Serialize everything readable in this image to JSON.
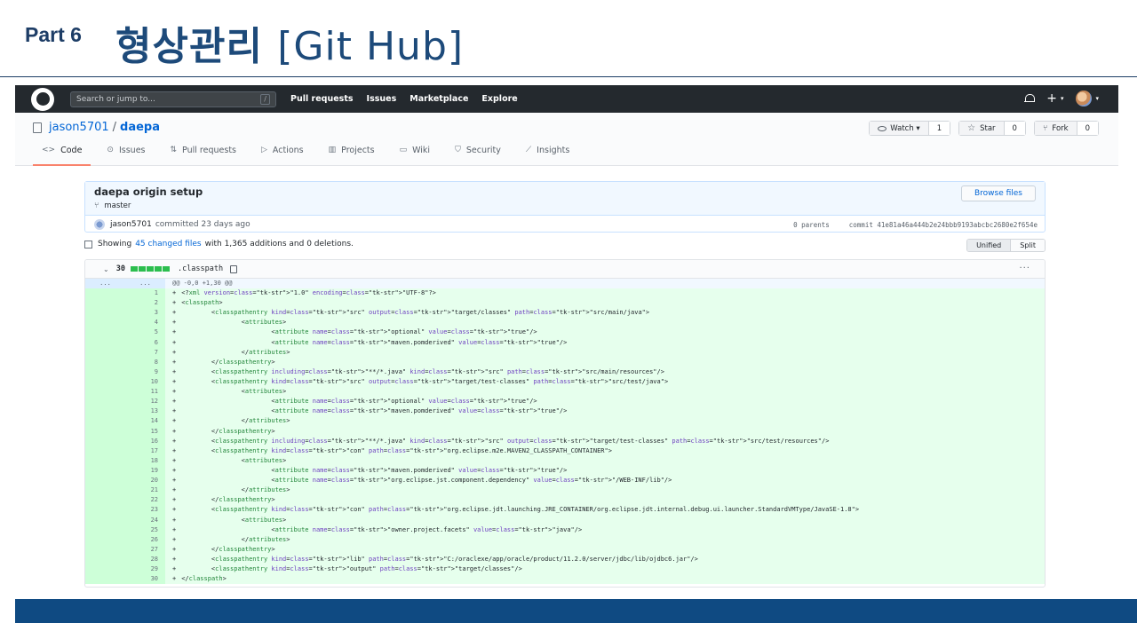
{
  "slide": {
    "part": "Part 6",
    "title": "형상관리",
    "title_suffix": "[Git Hub]"
  },
  "github": {
    "search": {
      "placeholder": "Search or jump to...",
      "shortcut": "/"
    },
    "nav": [
      "Pull requests",
      "Issues",
      "Marketplace",
      "Explore"
    ],
    "header_right": {
      "plus": "+",
      "caret": "▾"
    },
    "repo": {
      "owner": "jason5701",
      "separator": "/",
      "name": "daepa",
      "watch": {
        "label": "Watch",
        "count": "1"
      },
      "star": {
        "label": "Star",
        "count": "0"
      },
      "fork": {
        "label": "Fork",
        "count": "0"
      }
    },
    "tabs": [
      {
        "label": "Code",
        "icon": "<>"
      },
      {
        "label": "Issues",
        "icon": "⊙"
      },
      {
        "label": "Pull requests",
        "icon": "⇅"
      },
      {
        "label": "Actions",
        "icon": "▷"
      },
      {
        "label": "Projects",
        "icon": "▥"
      },
      {
        "label": "Wiki",
        "icon": "▭"
      },
      {
        "label": "Security",
        "icon": "⛉"
      },
      {
        "label": "Insights",
        "icon": "⟋"
      }
    ],
    "commit": {
      "title": "daepa origin setup",
      "branch": "master",
      "author": "jason5701",
      "committed": "committed 23 days ago",
      "parents": "0 parents",
      "commit_label": "commit",
      "sha": "41e81a46a444b2e24bbb9193abcbc2680e2f654e",
      "browse_label": "Browse files"
    },
    "summary": {
      "prefix": "Showing",
      "changed": "45 changed files",
      "suffix": "with 1,365 additions and 0 deletions."
    },
    "view": {
      "unified": "Unified",
      "split": "Split"
    },
    "file": {
      "count": "30",
      "name": ".classpath",
      "more": "···",
      "hunk_old": "...",
      "hunk_new": "...",
      "hunk": "@@ -0,0 +1,30 @@"
    },
    "diff_lines": [
      "<?xml version=\"1.0\" encoding=\"UTF-8\"?>",
      "<classpath>",
      "        <classpathentry kind=\"src\" output=\"target/classes\" path=\"src/main/java\">",
      "                <attributes>",
      "                        <attribute name=\"optional\" value=\"true\"/>",
      "                        <attribute name=\"maven.pomderived\" value=\"true\"/>",
      "                </attributes>",
      "        </classpathentry>",
      "        <classpathentry including=\"**/*.java\" kind=\"src\" path=\"src/main/resources\"/>",
      "        <classpathentry kind=\"src\" output=\"target/test-classes\" path=\"src/test/java\">",
      "                <attributes>",
      "                        <attribute name=\"optional\" value=\"true\"/>",
      "                        <attribute name=\"maven.pomderived\" value=\"true\"/>",
      "                </attributes>",
      "        </classpathentry>",
      "        <classpathentry including=\"**/*.java\" kind=\"src\" output=\"target/test-classes\" path=\"src/test/resources\"/>",
      "        <classpathentry kind=\"con\" path=\"org.eclipse.m2e.MAVEN2_CLASSPATH_CONTAINER\">",
      "                <attributes>",
      "                        <attribute name=\"maven.pomderived\" value=\"true\"/>",
      "                        <attribute name=\"org.eclipse.jst.component.dependency\" value=\"/WEB-INF/lib\"/>",
      "                </attributes>",
      "        </classpathentry>",
      "        <classpathentry kind=\"con\" path=\"org.eclipse.jdt.launching.JRE_CONTAINER/org.eclipse.jdt.internal.debug.ui.launcher.StandardVMType/JavaSE-1.8\">",
      "                <attributes>",
      "                        <attribute name=\"owner.project.facets\" value=\"java\"/>",
      "                </attributes>",
      "        </classpathentry>",
      "        <classpathentry kind=\"lib\" path=\"C:/oraclexe/app/oracle/product/11.2.0/server/jdbc/lib/ojdbc6.jar\"/>",
      "        <classpathentry kind=\"output\" path=\"target/classes\"/>",
      "</classpath>"
    ]
  },
  "colors": {
    "slide_title": "#1d4a7a",
    "footer_bar": "#0f4a82",
    "gh_header": "#24292e",
    "added_bg": "#e6ffed",
    "added_gutter": "#cdffd8",
    "link": "#0366d6"
  }
}
